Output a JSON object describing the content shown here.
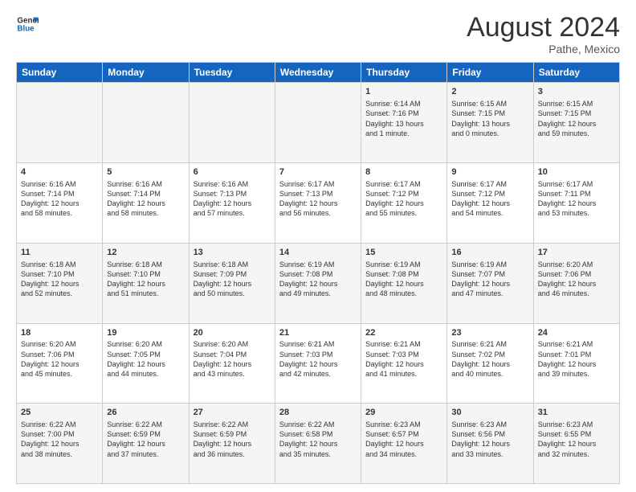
{
  "logo": {
    "line1": "General",
    "line2": "Blue"
  },
  "title": "August 2024",
  "subtitle": "Pathe, Mexico",
  "days": [
    "Sunday",
    "Monday",
    "Tuesday",
    "Wednesday",
    "Thursday",
    "Friday",
    "Saturday"
  ],
  "weeks": [
    [
      {
        "num": "",
        "text": ""
      },
      {
        "num": "",
        "text": ""
      },
      {
        "num": "",
        "text": ""
      },
      {
        "num": "",
        "text": ""
      },
      {
        "num": "1",
        "text": "Sunrise: 6:14 AM\nSunset: 7:16 PM\nDaylight: 13 hours\nand 1 minute."
      },
      {
        "num": "2",
        "text": "Sunrise: 6:15 AM\nSunset: 7:15 PM\nDaylight: 13 hours\nand 0 minutes."
      },
      {
        "num": "3",
        "text": "Sunrise: 6:15 AM\nSunset: 7:15 PM\nDaylight: 12 hours\nand 59 minutes."
      }
    ],
    [
      {
        "num": "4",
        "text": "Sunrise: 6:16 AM\nSunset: 7:14 PM\nDaylight: 12 hours\nand 58 minutes."
      },
      {
        "num": "5",
        "text": "Sunrise: 6:16 AM\nSunset: 7:14 PM\nDaylight: 12 hours\nand 58 minutes."
      },
      {
        "num": "6",
        "text": "Sunrise: 6:16 AM\nSunset: 7:13 PM\nDaylight: 12 hours\nand 57 minutes."
      },
      {
        "num": "7",
        "text": "Sunrise: 6:17 AM\nSunset: 7:13 PM\nDaylight: 12 hours\nand 56 minutes."
      },
      {
        "num": "8",
        "text": "Sunrise: 6:17 AM\nSunset: 7:12 PM\nDaylight: 12 hours\nand 55 minutes."
      },
      {
        "num": "9",
        "text": "Sunrise: 6:17 AM\nSunset: 7:12 PM\nDaylight: 12 hours\nand 54 minutes."
      },
      {
        "num": "10",
        "text": "Sunrise: 6:17 AM\nSunset: 7:11 PM\nDaylight: 12 hours\nand 53 minutes."
      }
    ],
    [
      {
        "num": "11",
        "text": "Sunrise: 6:18 AM\nSunset: 7:10 PM\nDaylight: 12 hours\nand 52 minutes."
      },
      {
        "num": "12",
        "text": "Sunrise: 6:18 AM\nSunset: 7:10 PM\nDaylight: 12 hours\nand 51 minutes."
      },
      {
        "num": "13",
        "text": "Sunrise: 6:18 AM\nSunset: 7:09 PM\nDaylight: 12 hours\nand 50 minutes."
      },
      {
        "num": "14",
        "text": "Sunrise: 6:19 AM\nSunset: 7:08 PM\nDaylight: 12 hours\nand 49 minutes."
      },
      {
        "num": "15",
        "text": "Sunrise: 6:19 AM\nSunset: 7:08 PM\nDaylight: 12 hours\nand 48 minutes."
      },
      {
        "num": "16",
        "text": "Sunrise: 6:19 AM\nSunset: 7:07 PM\nDaylight: 12 hours\nand 47 minutes."
      },
      {
        "num": "17",
        "text": "Sunrise: 6:20 AM\nSunset: 7:06 PM\nDaylight: 12 hours\nand 46 minutes."
      }
    ],
    [
      {
        "num": "18",
        "text": "Sunrise: 6:20 AM\nSunset: 7:06 PM\nDaylight: 12 hours\nand 45 minutes."
      },
      {
        "num": "19",
        "text": "Sunrise: 6:20 AM\nSunset: 7:05 PM\nDaylight: 12 hours\nand 44 minutes."
      },
      {
        "num": "20",
        "text": "Sunrise: 6:20 AM\nSunset: 7:04 PM\nDaylight: 12 hours\nand 43 minutes."
      },
      {
        "num": "21",
        "text": "Sunrise: 6:21 AM\nSunset: 7:03 PM\nDaylight: 12 hours\nand 42 minutes."
      },
      {
        "num": "22",
        "text": "Sunrise: 6:21 AM\nSunset: 7:03 PM\nDaylight: 12 hours\nand 41 minutes."
      },
      {
        "num": "23",
        "text": "Sunrise: 6:21 AM\nSunset: 7:02 PM\nDaylight: 12 hours\nand 40 minutes."
      },
      {
        "num": "24",
        "text": "Sunrise: 6:21 AM\nSunset: 7:01 PM\nDaylight: 12 hours\nand 39 minutes."
      }
    ],
    [
      {
        "num": "25",
        "text": "Sunrise: 6:22 AM\nSunset: 7:00 PM\nDaylight: 12 hours\nand 38 minutes."
      },
      {
        "num": "26",
        "text": "Sunrise: 6:22 AM\nSunset: 6:59 PM\nDaylight: 12 hours\nand 37 minutes."
      },
      {
        "num": "27",
        "text": "Sunrise: 6:22 AM\nSunset: 6:59 PM\nDaylight: 12 hours\nand 36 minutes."
      },
      {
        "num": "28",
        "text": "Sunrise: 6:22 AM\nSunset: 6:58 PM\nDaylight: 12 hours\nand 35 minutes."
      },
      {
        "num": "29",
        "text": "Sunrise: 6:23 AM\nSunset: 6:57 PM\nDaylight: 12 hours\nand 34 minutes."
      },
      {
        "num": "30",
        "text": "Sunrise: 6:23 AM\nSunset: 6:56 PM\nDaylight: 12 hours\nand 33 minutes."
      },
      {
        "num": "31",
        "text": "Sunrise: 6:23 AM\nSunset: 6:55 PM\nDaylight: 12 hours\nand 32 minutes."
      }
    ]
  ]
}
